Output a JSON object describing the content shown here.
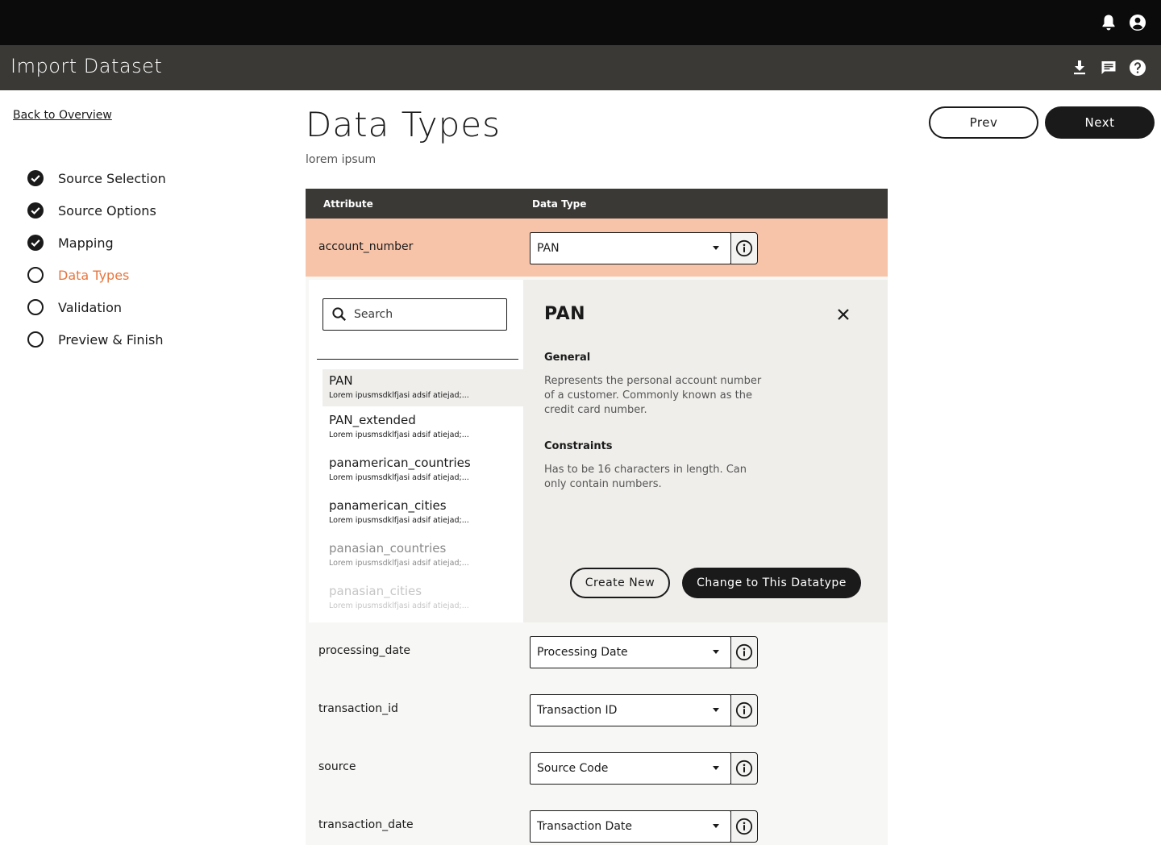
{
  "header": {
    "title": "Import Dataset",
    "top_icons": [
      "bell-icon",
      "account-icon"
    ],
    "sub_icons": [
      "download-icon",
      "comment-icon",
      "help-icon"
    ]
  },
  "nav": {
    "back_label": "Back to Overview",
    "steps": [
      {
        "label": "Source Selection",
        "done": true
      },
      {
        "label": "Source Options",
        "done": true
      },
      {
        "label": "Mapping",
        "done": true
      },
      {
        "label": "Data Types",
        "done": false,
        "active": true
      },
      {
        "label": "Validation",
        "done": false
      },
      {
        "label": "Preview & Finish",
        "done": false
      }
    ]
  },
  "main": {
    "title": "Data Types",
    "subtitle": "lorem ipsum",
    "prev_label": "Prev",
    "next_label": "Next",
    "accent_color": "#e8763f",
    "table": {
      "headers": {
        "attribute": "Attribute",
        "data_type": "Data Type"
      },
      "rows": [
        {
          "attribute": "account_number",
          "data_type": "PAN",
          "selected": true
        },
        {
          "attribute": "processing_date",
          "data_type": "Processing Date"
        },
        {
          "attribute": "transaction_id",
          "data_type": "Transaction ID"
        },
        {
          "attribute": "source",
          "data_type": "Source Code"
        },
        {
          "attribute": "transaction_date",
          "data_type": "Transaction Date"
        }
      ]
    },
    "picker": {
      "search_placeholder": "Search",
      "items": [
        {
          "name": "PAN",
          "desc": "Lorem ipusmsdklfjasi adsif atiejad;...",
          "selected": true
        },
        {
          "name": "PAN_extended",
          "desc": "Lorem ipusmsdklfjasi adsif atiejad;..."
        },
        {
          "name": "panamerican_countries",
          "desc": "Lorem ipusmsdklfjasi adsif atiejad;..."
        },
        {
          "name": "panamerican_cities",
          "desc": "Lorem ipusmsdklfjasi adsif atiejad;..."
        },
        {
          "name": "panasian_countries",
          "desc": "Lorem ipusmsdklfjasi adsif atiejad;..."
        },
        {
          "name": "panasian_cities",
          "desc": "Lorem ipusmsdklfjasi adsif atiejad;..."
        }
      ],
      "detail": {
        "title": "PAN",
        "general_heading": "General",
        "general_text": "Represents the personal account number of a customer. Commonly known as the credit card number.",
        "constraints_heading": "Constraints",
        "constraints_text": "Has to be 16 characters in length. Can only contain numbers.",
        "create_label": "Create New",
        "change_label": "Change to This Datatype"
      }
    }
  }
}
